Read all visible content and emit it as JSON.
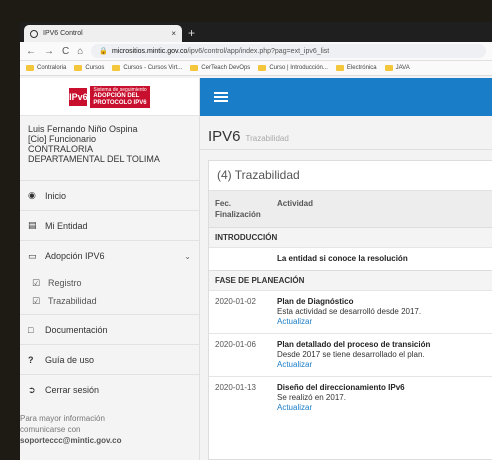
{
  "browser": {
    "tab_title": "IPV6 Control",
    "tab_close": "×",
    "new_tab": "+",
    "nav_buttons": [
      "←",
      "→",
      "C",
      "⌂"
    ],
    "url_host": "micrositios.mintic.gov.co",
    "url_path": "/ipv6/control/app/index.php?pag=ext_ipv6_list",
    "bookmarks": [
      "Contraloria",
      "Cursos",
      "Cursos - Cursos Virt...",
      "CerTeach DevOps",
      "Curso | Introducción...",
      "Electrónica",
      "JAVA"
    ]
  },
  "sidebar": {
    "logo_mark": "IPv6",
    "logo_line1": "Sistema de seguimiento",
    "logo_line2": "ADOPCIÓN DEL",
    "logo_line3": "PROTOCOLO IPV6",
    "user_name": "Luis Fernando Niño Ospina",
    "user_role": "[Cio] Funcionario",
    "entity_line1": "CONTRALORIA",
    "entity_line2": "DEPARTAMENTAL DEL TOLIMA",
    "menu": {
      "inicio": "Inicio",
      "mi_entidad": "Mi Entidad",
      "adopcion": "Adopción IPV6",
      "registro": "Registro",
      "trazabilidad": "Trazabilidad",
      "documentacion": "Documentación",
      "guia": "Guía de uso",
      "cerrar": "Cerrar sesión"
    },
    "info_line1": "Para mayor información",
    "info_line2": "comunicarse con",
    "info_email": "soporteccc@mintic.gov.co"
  },
  "header": {
    "title": "IPV6",
    "subtitle": "Trazabilidad"
  },
  "card": {
    "title": "(4) Trazabilidad",
    "col_date_1": "Fec.",
    "col_date_2": "Finalización",
    "col_activity": "Actividad",
    "sections": [
      {
        "name": "INTRODUCCIÓN",
        "rows": [
          {
            "date": "",
            "activity": "La entidad si conoce la resolución",
            "desc": "",
            "link": ""
          }
        ]
      },
      {
        "name": "FASE DE PLANEACIÓN",
        "rows": [
          {
            "date": "2020-01-02",
            "activity": "Plan de Diagnóstico",
            "desc": "Esta actividad se desarrolló desde 2017.",
            "link": "Actualizar"
          },
          {
            "date": "2020-01-06",
            "activity": "Plan detallado del proceso de transición",
            "desc": "Desde 2017 se tiene desarrollado el plan.",
            "link": "Actualizar"
          },
          {
            "date": "2020-01-13",
            "activity": "Diseño del direccionamiento IPv6",
            "desc": "Se realizó en 2017.",
            "link": "Actualizar"
          }
        ]
      }
    ]
  },
  "colors": {
    "brand_red": "#c8102e",
    "topbar_blue": "#1a7dc7",
    "link_blue": "#1a7dc7"
  }
}
